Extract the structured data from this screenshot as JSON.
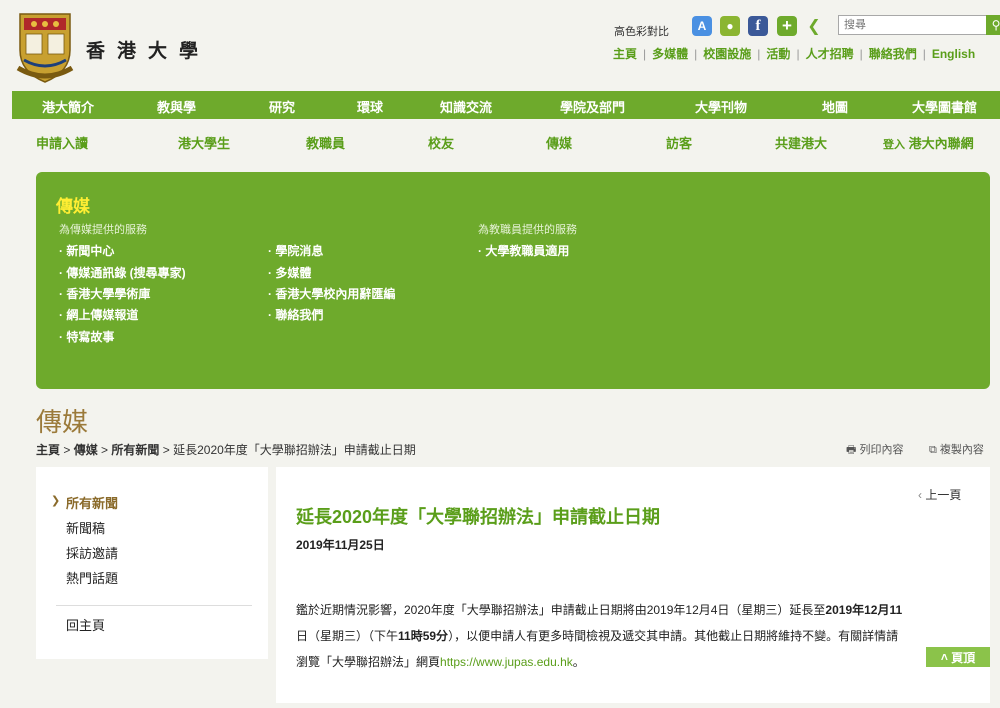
{
  "header": {
    "univ_name": "香港大學",
    "contrast_label": "高色彩對比",
    "search_placeholder": "搜尋",
    "top_links": [
      "主頁",
      "多媒體",
      "校園設施",
      "活動",
      "人才招聘",
      "聯絡我們",
      "English"
    ]
  },
  "nav_primary": [
    "港大簡介",
    "教與學",
    "研究",
    "環球",
    "知識交流",
    "學院及部門",
    "大學刊物",
    "地圖",
    "大學圖書館"
  ],
  "nav_secondary": [
    "申請入讀",
    "港大學生",
    "教職員",
    "校友",
    "傳媒",
    "訪客",
    "共建港大"
  ],
  "nav_login": {
    "prefix": "登入",
    "label": "港大內聯網"
  },
  "panel": {
    "title": "傳媒",
    "media_heading": "為傳媒提供的服務",
    "staff_heading": "為教職員提供的服務",
    "col1": [
      "新聞中心",
      "傳媒通訊錄 (搜尋專家)",
      "香港大學學術庫",
      "網上傳媒報道",
      "特寫故事"
    ],
    "col2": [
      "學院消息",
      "多媒體",
      "香港大學校內用辭匯編",
      "聯絡我們"
    ],
    "col3": [
      "大學教職員適用"
    ]
  },
  "page": {
    "title": "傳媒",
    "breadcrumb": [
      "主頁",
      "傳媒",
      "所有新聞",
      "延長2020年度「大學聯招辦法」申請截止日期"
    ],
    "print_label": "列印內容",
    "copy_label": "複製內容"
  },
  "left_menu": {
    "items": [
      "所有新聞",
      "新聞稿",
      "採訪邀請",
      "熱門話題"
    ],
    "home": "回主頁"
  },
  "article": {
    "prev_label": "上一頁",
    "title": "延長2020年度「大學聯招辦法」申請截止日期",
    "date": "2019年11月25日",
    "body_part1": "鑑於近期情況影響，2020年度「大學聯招辦法」申請截止日期將由2019年12月4日（星期三）延長至",
    "body_bold1": "2019年12月11",
    "body_line2_bold": "日（星期三）（下午",
    "body_bold_time": "11時59分",
    "body_line2_rest": "），以便申請人有更多時間檢視及遞交其申請。其他截止日期將維持不變。有關詳情請",
    "body_line3": "瀏覽「大學聯招辦法」網頁",
    "body_link": "https://www.jupas.edu.hk",
    "body_end": "。",
    "top_label": "頁頂"
  }
}
